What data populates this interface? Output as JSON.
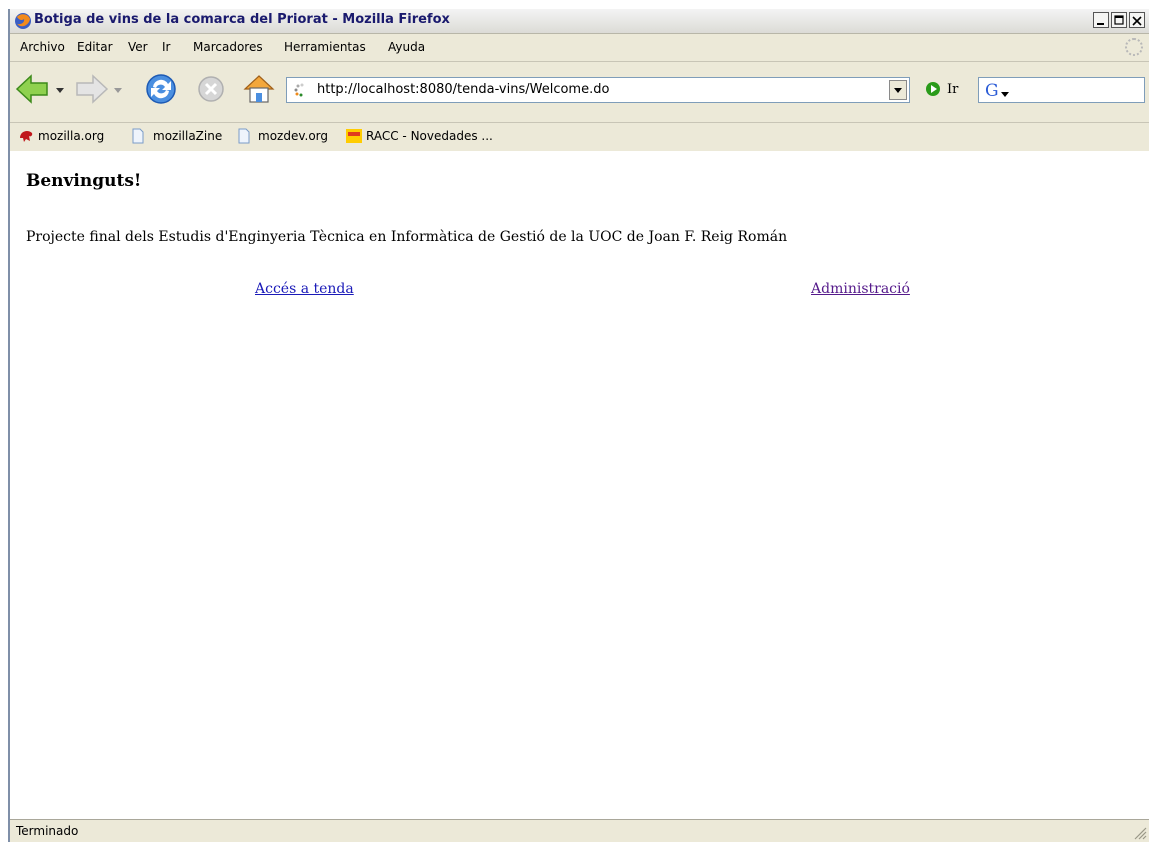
{
  "window": {
    "title": "Botiga de vins de la comarca del Priorat - Mozilla Firefox"
  },
  "menu": {
    "items": [
      {
        "label": "Archivo"
      },
      {
        "label": "Editar"
      },
      {
        "label": "Ver"
      },
      {
        "label": "Ir"
      },
      {
        "label": "Marcadores"
      },
      {
        "label": "Herramientas"
      },
      {
        "label": "Ayuda"
      }
    ]
  },
  "nav": {
    "url": "http://localhost:8080/tenda-vins/Welcome.do",
    "go_label": "Ir",
    "icons": [
      "back-arrow-icon",
      "dropdown-icon",
      "forward-arrow-icon",
      "dropdown-icon",
      "reload-icon",
      "stop-icon",
      "home-icon",
      "page-loading-icon",
      "go-icon",
      "google-search-icon"
    ]
  },
  "bookmarks": [
    {
      "label": "mozilla.org",
      "icon": "mozilla-icon"
    },
    {
      "label": "mozillaZine",
      "icon": "page-icon"
    },
    {
      "label": "mozdev.org",
      "icon": "page-icon"
    },
    {
      "label": "RACC - Novedades ...",
      "icon": "racc-icon"
    }
  ],
  "page": {
    "heading": "Benvinguts!",
    "intro": "Projecte final dels Estudis d'Enginyeria Tècnica en Informàtica de Gestió de la UOC de Joan F. Reig Román",
    "links": {
      "shop": "Accés a tenda",
      "admin": "Administració"
    }
  },
  "status": {
    "text": "Terminado"
  },
  "colors": {
    "link": "#1a1ab8",
    "visited_link": "#551a8b",
    "chrome": "#ece9d8"
  }
}
